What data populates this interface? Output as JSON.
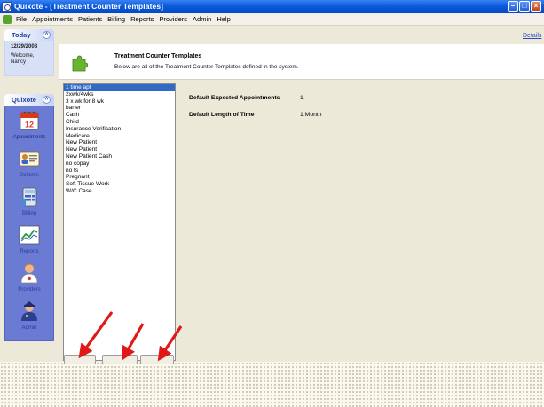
{
  "window": {
    "title": "Quixote - [Treatment Counter Templates]"
  },
  "menu": {
    "items": [
      "File",
      "Appointments",
      "Patients",
      "Billing",
      "Reports",
      "Providers",
      "Admin",
      "Help"
    ]
  },
  "today_panel": {
    "title": "Today",
    "date": "12/29/2008",
    "welcome": "Welcome,",
    "user": "Nancy"
  },
  "nav_panel": {
    "title": "Quixote",
    "items": [
      {
        "label": "Appointments",
        "icon": "calendar-icon"
      },
      {
        "label": "Patients",
        "icon": "patient-card-icon"
      },
      {
        "label": "Billing",
        "icon": "calculator-icon"
      },
      {
        "label": "Reports",
        "icon": "chart-icon"
      },
      {
        "label": "Providers",
        "icon": "doctor-icon"
      },
      {
        "label": "Admin",
        "icon": "admin-officer-icon"
      }
    ],
    "calendar_day": "12"
  },
  "header": {
    "details_link": "Details",
    "title": "Treatment Counter Templates",
    "description": "Below are all of the Treatment Counter Templates defined in the system.",
    "icon": "puzzle-icon"
  },
  "templates": {
    "items": [
      "1 time apt",
      "2xwk/4wks",
      "3 x wk for 8 wk",
      "barter",
      "Cash",
      "Child",
      "Insurance Verification",
      "Medicare",
      "New Patient",
      "New Patient",
      "New Patient Cash",
      "no copay",
      "no ts",
      "Pregnant",
      "Soft Tissue Work",
      "W/C Case"
    ],
    "selected_index": 0
  },
  "details": {
    "expected_appointments_label": "Default Expected Appointments",
    "expected_appointments_value": "1",
    "length_label": "Default Length of Time",
    "length_value": "1 Month"
  },
  "colors": {
    "titlebar": "#0a5cdb",
    "nav_background": "#6b7ad2",
    "selection": "#316ac5",
    "arrow": "#e01818"
  }
}
